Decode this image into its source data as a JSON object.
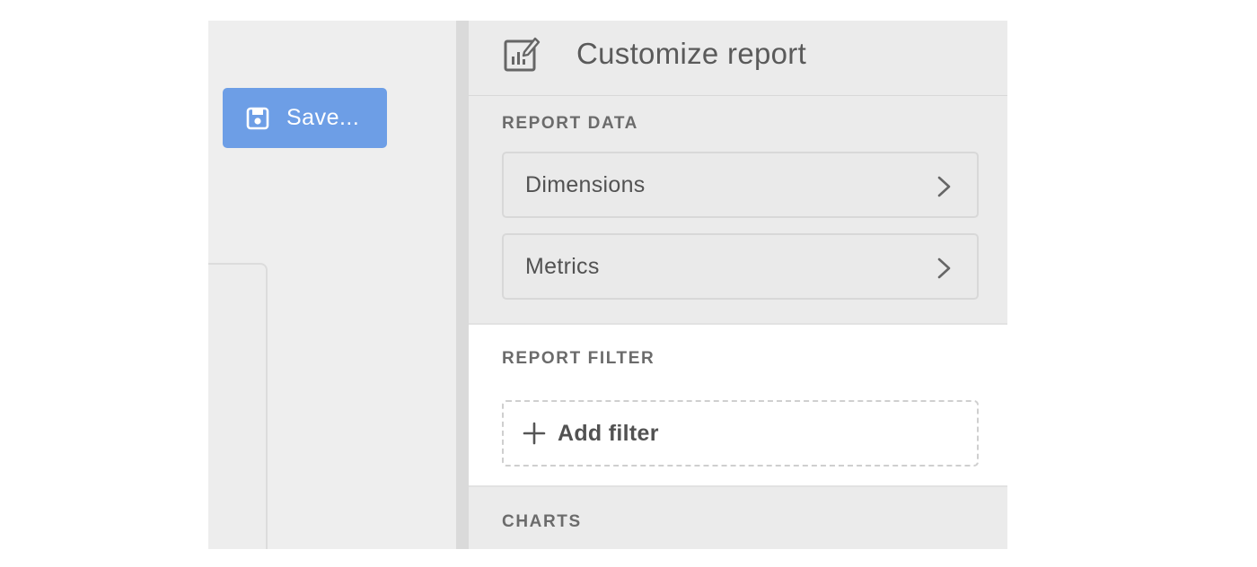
{
  "toolbar": {
    "save_label": "Save...",
    "save_icon": "save-icon"
  },
  "panel": {
    "title": "Customize report",
    "title_icon": "report-edit-icon",
    "sections": {
      "report_data": {
        "label": "REPORT DATA",
        "items": [
          {
            "label": "Dimensions",
            "icon": "chevron-right-icon"
          },
          {
            "label": "Metrics",
            "icon": "chevron-right-icon"
          }
        ]
      },
      "report_filter": {
        "label": "REPORT FILTER",
        "add_filter_label": "Add filter",
        "add_filter_icon": "plus-icon"
      },
      "charts": {
        "label": "CHARTS"
      }
    }
  },
  "colors": {
    "save_button_bg": "#6d9ee6",
    "panel_bg": "#ebebeb",
    "filter_section_bg": "#ffffff",
    "text": "#525252"
  }
}
